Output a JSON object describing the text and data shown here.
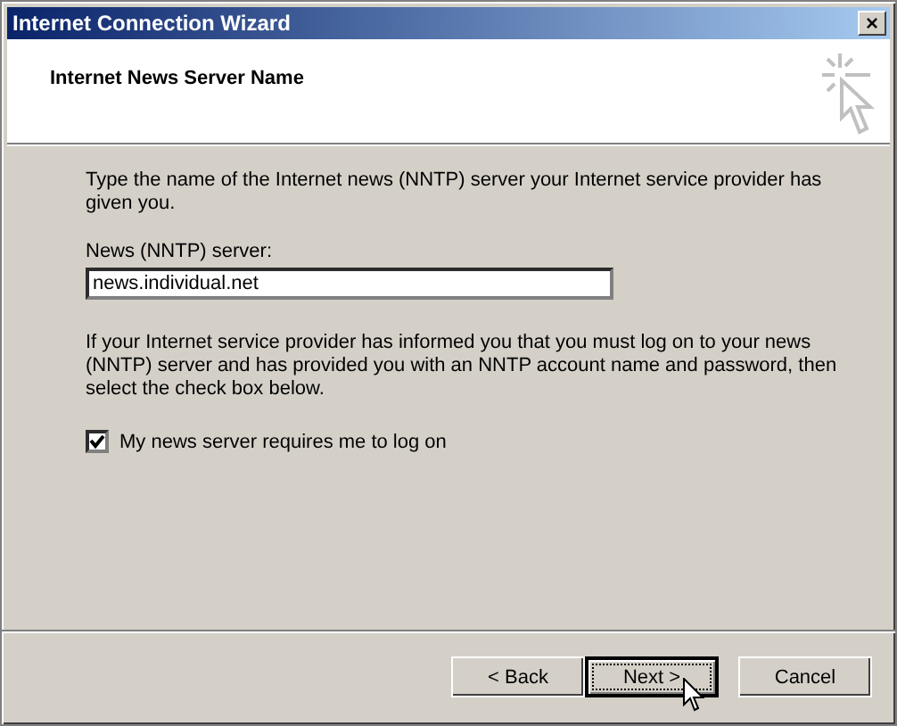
{
  "window": {
    "title": "Internet Connection Wizard",
    "close_button": "×"
  },
  "header": {
    "title": "Internet News Server Name"
  },
  "body": {
    "intro": "Type the name of the Internet news (NNTP) server your Internet service provider has given you.",
    "field": {
      "label": "News (NNTP) server:",
      "value": "news.individual.net"
    },
    "note": "If your Internet service provider has informed you that you must log on to your news (NNTP) server and has provided you with an NNTP account name and password, then select the check box below.",
    "checkbox": {
      "label": "My news server requires me to log on",
      "checked": true
    }
  },
  "buttons": [
    {
      "label": "< Back",
      "default": false,
      "hovered": false
    },
    {
      "label": "Next >",
      "default": true,
      "hovered": true
    },
    {
      "label": "Cancel",
      "default": false,
      "hovered": false
    }
  ]
}
